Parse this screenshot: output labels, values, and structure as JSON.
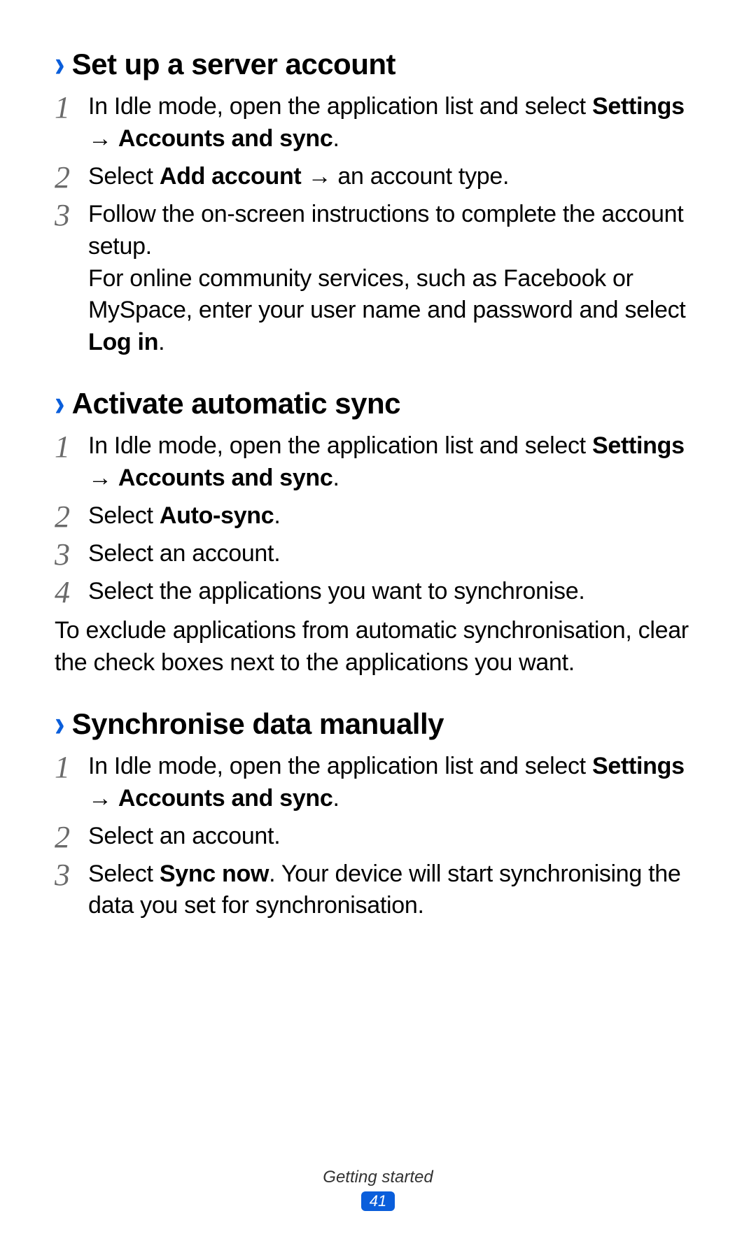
{
  "sections": [
    {
      "heading": "Set up a server account",
      "steps": [
        {
          "num": "1",
          "html": "In Idle mode, open the application list and select <b>Settings</b> → <b>Accounts and sync</b>."
        },
        {
          "num": "2",
          "html": "Select <b>Add account</b> → an account type."
        },
        {
          "num": "3",
          "html": "Follow the on-screen instructions to complete the account setup.<br>For online community services, such as Facebook or MySpace, enter your user name and password and select <b>Log in</b>."
        }
      ]
    },
    {
      "heading": "Activate automatic sync",
      "steps": [
        {
          "num": "1",
          "html": "In Idle mode, open the application list and select <b>Settings</b> → <b>Accounts and sync</b>."
        },
        {
          "num": "2",
          "html": "Select <b>Auto-sync</b>."
        },
        {
          "num": "3",
          "html": "Select an account."
        },
        {
          "num": "4",
          "html": "Select the applications you want to synchronise."
        }
      ],
      "note": "To exclude applications from automatic synchronisation, clear the check boxes next to the applications you want."
    },
    {
      "heading": "Synchronise data manually",
      "steps": [
        {
          "num": "1",
          "html": "In Idle mode, open the application list and select <b>Settings</b> → <b>Accounts and sync</b>."
        },
        {
          "num": "2",
          "html": "Select an account."
        },
        {
          "num": "3",
          "html": "Select <b>Sync now</b>. Your device will start synchronising the data you set for synchronisation."
        }
      ]
    }
  ],
  "footer": {
    "label": "Getting started",
    "page": "41"
  },
  "chevron_glyph": "›"
}
